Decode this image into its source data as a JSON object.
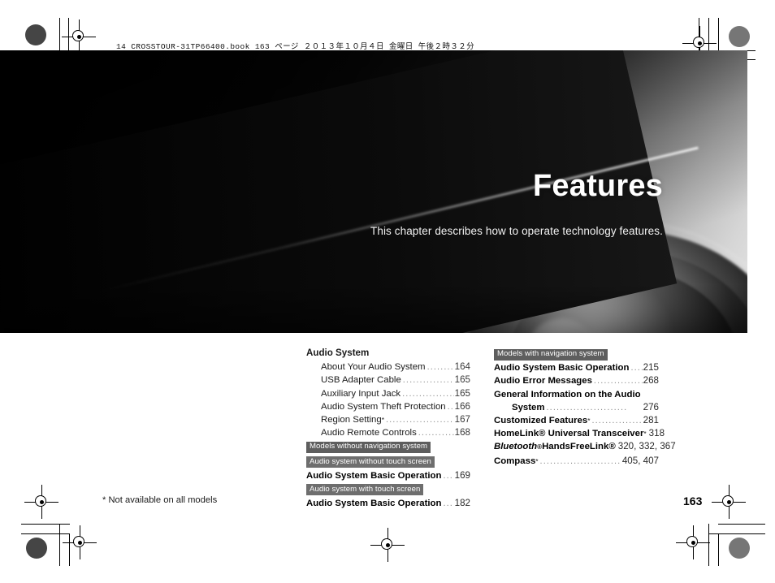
{
  "print_header": "14 CROSSTOUR-31TP66400.book   163 ページ   ２０１３年１０月４日   金曜日   午後２時３２分",
  "banner": {
    "title": "Features",
    "subtitle": "This chapter describes how to operate technology features.",
    "image_name": "speaker-woofer-photo"
  },
  "toc": {
    "left_column": {
      "group_title": "Audio System",
      "entries": [
        {
          "label": "About Your Audio System",
          "page": "164"
        },
        {
          "label": "USB Adapter Cable",
          "page": "165"
        },
        {
          "label": "Auxiliary Input Jack",
          "page": "165"
        },
        {
          "label": "Audio System Theft Protection",
          "page": "166"
        },
        {
          "label": "Region Setting",
          "page": "167",
          "asterisk": true
        },
        {
          "label": "Audio Remote Controls",
          "page": "168"
        }
      ],
      "tag_models": "Models without navigation system",
      "tag_without_touch": "Audio system without touch screen",
      "entry_without_touch": {
        "label": "Audio System Basic Operation",
        "page": "169"
      },
      "tag_with_touch": "Audio system with touch screen",
      "entry_with_touch": {
        "label": "Audio System Basic Operation",
        "page": "182"
      }
    },
    "right_column": {
      "tag_models": "Models with navigation system",
      "entries": [
        {
          "label": "Audio System Basic Operation",
          "page": "215"
        },
        {
          "label": "Audio Error Messages",
          "page": "268"
        },
        {
          "label": "General Information on the Audio",
          "label2": "System",
          "page": "276"
        },
        {
          "label": "Customized Features",
          "page": "281",
          "asterisk": true
        },
        {
          "label": "HomeLink® Universal Transceiver",
          "page": "318",
          "asterisk": true
        },
        {
          "label_italic": "Bluetooth",
          "label_reg": "®",
          "label_rest": " HandsFreeLink®",
          "page": "320, 332, 367"
        },
        {
          "label": "Compass",
          "page": "405, 407",
          "asterisk": true
        }
      ]
    }
  },
  "footnote": "* Not available on all models",
  "page_number": "163",
  "colors": {
    "tag_background": "#5e5e5e",
    "tag_text": "#ffffff",
    "banner_background": "#000000",
    "page_background": "#ffffff"
  }
}
